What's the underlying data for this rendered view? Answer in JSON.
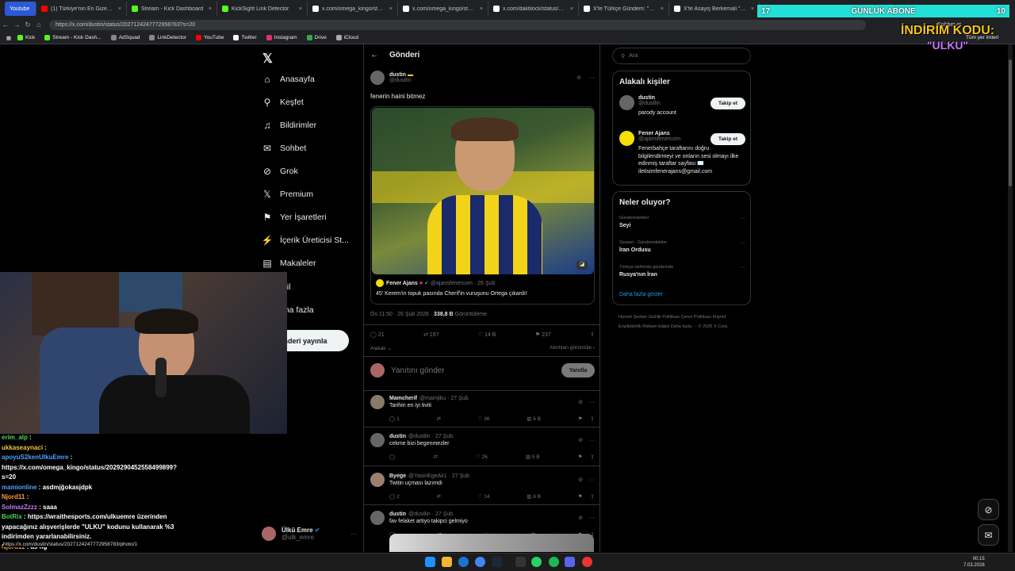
{
  "browser": {
    "tabs": [
      {
        "label": "Youtube",
        "color": "#3a6bde"
      },
      {
        "label": "(1) Türkiye'nin En Gizemli Olayı",
        "color": "#ff0000"
      },
      {
        "label": "Stream - Kick Dashboard",
        "color": "#53fc18"
      },
      {
        "label": "KickSight Link Detector",
        "color": "#53fc18"
      },
      {
        "label": "x.com/omega_kingo/status/20...",
        "color": "#ffffff"
      },
      {
        "label": "x.com/omega_kingo/status/20...",
        "color": "#ffffff"
      },
      {
        "label": "x.com/daktilock/status/202949...",
        "color": "#ffffff"
      },
      {
        "label": "X'te Türkçe Gündem: \"Türkiye'y...",
        "color": "#ffffff"
      },
      {
        "label": "X'te Asayiş Berkemali \"Eskişehi...",
        "color": "#ffffff"
      }
    ],
    "url": "https://x.com/dustin/status/2027124247772958783?s=20",
    "bookmarks": [
      "Kick",
      "Stream - Kick Dash...",
      "AdSquad",
      "LinkDetector",
      "YouTube",
      "Twitter",
      "Instagram",
      "Drive",
      "iCloud"
    ],
    "right_labels": {
      "chat": "Sohbet et",
      "all": "Tüm yer imleri"
    }
  },
  "overlay": {
    "sub_left": "17",
    "sub_title": "GÜNLÜK ABONE",
    "sub_right": "10",
    "promo_line1": "İNDİRİM KODU:",
    "promo_code": "\"ULKU\""
  },
  "nav": {
    "items": [
      "Anasayfa",
      "Keşfet",
      "Bildirimler",
      "Sohbet",
      "Grok",
      "Premium",
      "Yer İşaretleri",
      "İçerik Üreticisi St...",
      "Makaleler",
      "ofil",
      "aha fazla"
    ],
    "post_button": "nderi yayınla",
    "profile_name": "Ülkü Emre",
    "profile_handle": "@ulk_emre"
  },
  "main": {
    "header": "Gönderi",
    "post": {
      "name": "dustin",
      "handle": "@dus8in",
      "text": "fenerin haini bitmez",
      "quote_name": "Fener Ajans",
      "quote_handle": "@ajansfenercom · 26 Şub",
      "quote_text": "45' Kerem'in topuk pasında Cherif'in vuruşunu Ortega çıkardı!",
      "time": "Ös 11:50 · 26 Şub 2026 ·",
      "views_num": "338,8 B",
      "views_label": "Görüntüleme",
      "replies": "21",
      "reposts": "197",
      "likes": "14 B",
      "bookmarks": "237",
      "related_left": "Alakalı",
      "related_right": "Alıntıları görüntüle"
    },
    "reply_placeholder": "Yanıtını gönder",
    "reply_button": "Yanıtla",
    "replies": [
      {
        "name": "Mamcherif",
        "meta": "@mamjiku · 27 Şub",
        "text": "Tarihin en iyi tiviti",
        "r": "1",
        "rt": "",
        "l": "36",
        "v": "6 B"
      },
      {
        "name": "dustin",
        "meta": "@dus8in · 27 Şub",
        "text": "cekme bizi begenmezler",
        "r": "",
        "rt": "",
        "l": "26",
        "v": "5 B"
      },
      {
        "name": "Byege",
        "meta": "@YasinEgeAk1 · 27 Şub",
        "text": "Twitin uçması lazımdı",
        "r": "2",
        "rt": "",
        "l": "14",
        "v": "6 B"
      },
      {
        "name": "dustin",
        "meta": "@dus8in · 27 Şub",
        "text": "fav felaket artiyo takipci gelmiyo",
        "r": "",
        "rt": "",
        "l": "",
        "v": ""
      }
    ]
  },
  "right": {
    "search_placeholder": "Ara",
    "related_title": "Alakalı kişiler",
    "people": [
      {
        "name": "dustin",
        "handle": "@dus8in",
        "bio": "parody account",
        "button": "Takip et"
      },
      {
        "name": "Fener Ajans",
        "handle": "@ajansfenercom",
        "bio": "Fenerbahçe taraftarını doğru bilgilendirmeyi ve onların sesi olmayı ilke edinmiş taraftar sayfası ✉️ iletisimfenerajans@gmail.com",
        "button": "Takip et"
      }
    ],
    "trends_title": "Neler oluyor?",
    "trends": [
      {
        "meta": "Gündemdekiler",
        "name": "Seyi"
      },
      {
        "meta": "Siyaset · Gündemdekiler",
        "name": "İran Ordusu"
      },
      {
        "meta": "Türkiye tarihinde gündemde",
        "name": "Rusya'nın İran"
      }
    ],
    "show_more": "Daha fazla göster",
    "footer": "Hizmet Şartları   Gizlilik Politikası   Çerez Politikası   Imprint   Erişilebilirlik   Reklam bilgisi   Daha fazla ···   © 2026 X Corp."
  },
  "chat": [
    {
      "user": "erim_alp",
      "color": "#4fd15b",
      "msg": ""
    },
    {
      "user": "ukkaseaynaci",
      "color": "#f5c542",
      "msg": ""
    },
    {
      "user": "apoyuS2kenUlkuEmre",
      "color": "#4aa3ff",
      "msg": ""
    },
    {
      "user": "",
      "color": "#ffffff",
      "msg": "https://x.com/omega_kingo/status/2029290452558499899?"
    },
    {
      "user": "",
      "color": "#ffffff",
      "msg": "s=20"
    },
    {
      "user": "mamionline",
      "color": "#4aa3ff",
      "msg": "asdmjğokasjdpk"
    },
    {
      "user": "Njord11",
      "color": "#ff9a3c",
      "msg": ""
    },
    {
      "user": "SolmazZzzz",
      "color": "#c778ff",
      "msg": "saaa"
    },
    {
      "user": "BotRix",
      "color": "#4fd15b",
      "msg": "https://wraithesports.com/ulkuemre üzerinden"
    },
    {
      "user": "",
      "color": "#ffffff",
      "msg": "yapacağınız alışverişlerde \"ULKU\" kodunu kullanarak %3"
    },
    {
      "user": "",
      "color": "#ffffff",
      "msg": "indirimden yararlanabilirsiniz."
    },
    {
      "user": "Njord11",
      "color": "#ff9a3c",
      "msg": "as hg"
    },
    {
      "user": "SolmazZzzz",
      "color": "#c778ff",
      "msg": "hb"
    }
  ],
  "status_url": "https://x.com/dustin/status/2027124247772958783/photo/1",
  "taskbar": {
    "time": "00:15",
    "date": "7.03.2026"
  }
}
